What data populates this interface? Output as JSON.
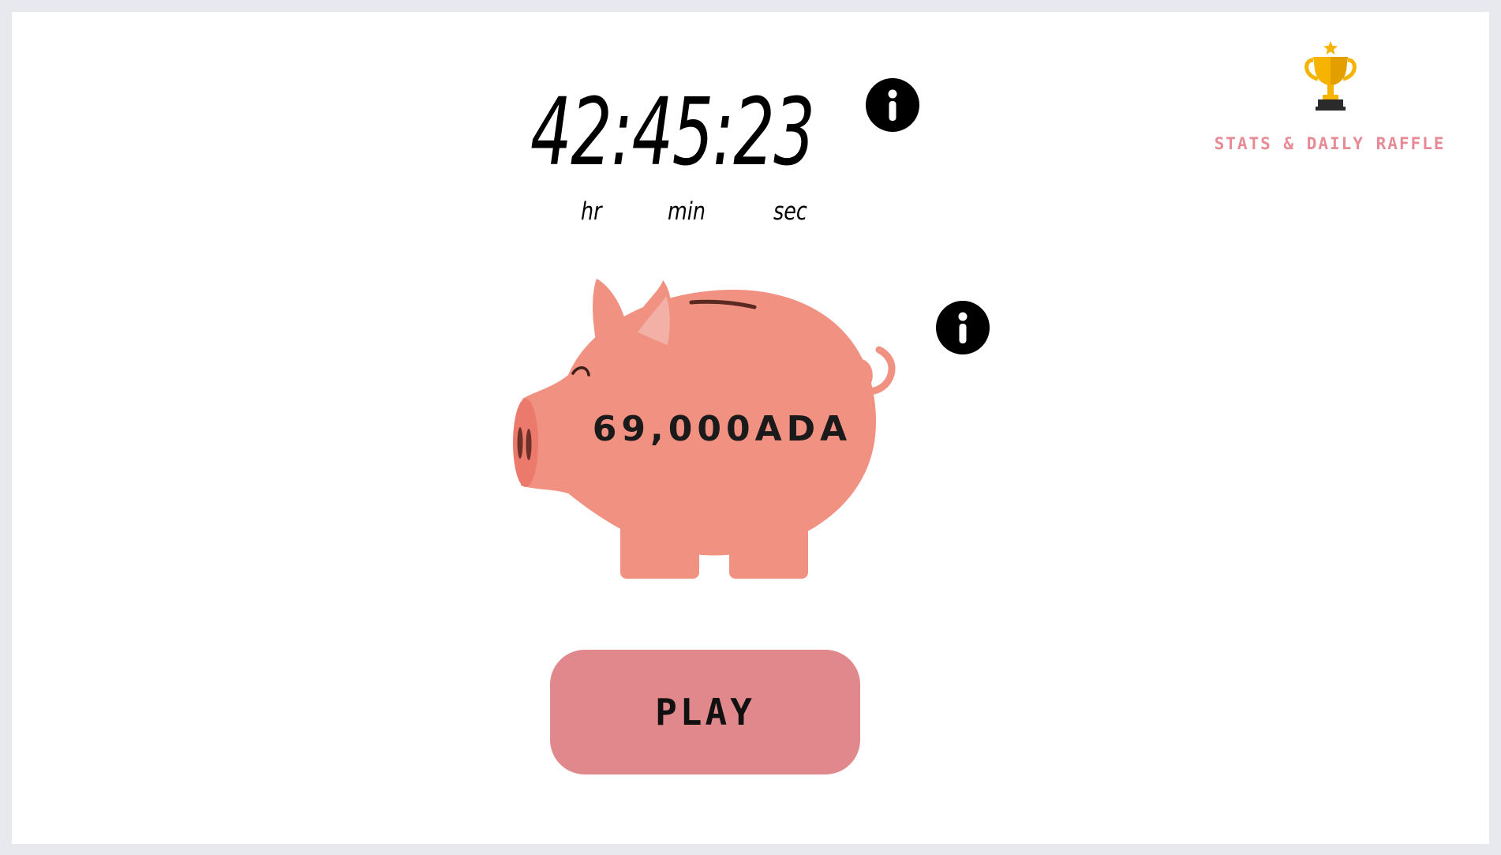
{
  "timer": {
    "display": "42:45:23",
    "units": {
      "hours": "hr",
      "minutes": "min",
      "seconds": "sec"
    }
  },
  "header": {
    "stats_link_label": "STATS & DAILY RAFFLE",
    "trophy_icon": "trophy-icon"
  },
  "pot": {
    "amount": "69,000ADA"
  },
  "actions": {
    "play_label": "PLAY"
  },
  "icons": {
    "timer_info": "info-icon",
    "pot_info": "info-icon",
    "piggy_bank": "piggy-bank-icon"
  },
  "colors": {
    "background": "#e8e9ee",
    "card": "#ffffff",
    "pig_body": "#f19182",
    "pig_snout": "#ec7a6c",
    "play_button": "#e0888c",
    "stats_link": "#e78a95",
    "trophy_gold": "#f6b400"
  }
}
